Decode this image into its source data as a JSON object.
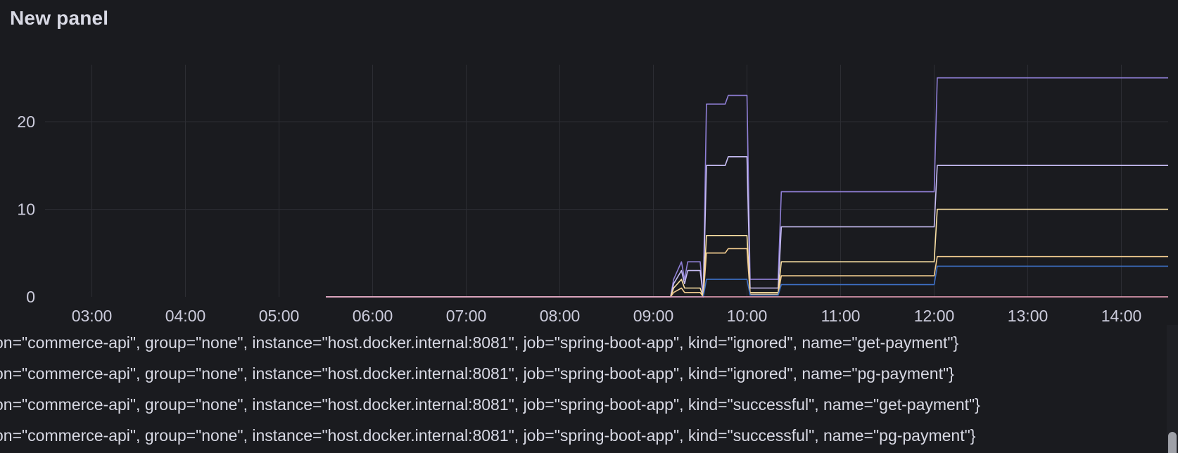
{
  "panel": {
    "title": "New panel"
  },
  "chart_data": {
    "type": "line",
    "title": "New panel",
    "xlabel": "",
    "ylabel": "",
    "xlim": [
      "02:30",
      "14:30"
    ],
    "ylim": [
      0,
      26.5
    ],
    "x_ticks": [
      "03:00",
      "04:00",
      "05:00",
      "06:00",
      "07:00",
      "08:00",
      "09:00",
      "10:00",
      "11:00",
      "12:00",
      "13:00",
      "14:00"
    ],
    "y_ticks": [
      0,
      10,
      20
    ],
    "grid": true,
    "legend_position": "bottom",
    "series": [
      {
        "label": "on=\"commerce-api\", group=\"none\", instance=\"host.docker.internal:8081\", job=\"spring-boot-app\", kind=\"ignored\", name=\"get-payment\"}",
        "color": "#8f7fd6",
        "points": [
          [
            "05:30",
            0
          ],
          [
            "09:11",
            0
          ],
          [
            "09:13",
            2
          ],
          [
            "09:18",
            4
          ],
          [
            "09:20",
            2
          ],
          [
            "09:22",
            4
          ],
          [
            "09:30",
            4
          ],
          [
            "09:32",
            0
          ],
          [
            "09:34",
            22
          ],
          [
            "09:46",
            22
          ],
          [
            "09:48",
            23
          ],
          [
            "10:00",
            23
          ],
          [
            "10:02",
            2
          ],
          [
            "10:20",
            2
          ],
          [
            "10:22",
            12
          ],
          [
            "12:00",
            12
          ],
          [
            "12:02",
            25
          ],
          [
            "14:30",
            25
          ]
        ]
      },
      {
        "label": "on=\"commerce-api\", group=\"none\", instance=\"host.docker.internal:8081\", job=\"spring-boot-app\", kind=\"ignored\", name=\"pg-payment\"}",
        "color": "#c7bdf4",
        "points": [
          [
            "05:30",
            0
          ],
          [
            "09:11",
            0
          ],
          [
            "09:13",
            1.5
          ],
          [
            "09:18",
            3
          ],
          [
            "09:20",
            1.5
          ],
          [
            "09:22",
            3
          ],
          [
            "09:30",
            3
          ],
          [
            "09:32",
            0
          ],
          [
            "09:34",
            15
          ],
          [
            "09:46",
            15
          ],
          [
            "09:48",
            16
          ],
          [
            "10:00",
            16
          ],
          [
            "10:02",
            1
          ],
          [
            "10:20",
            1
          ],
          [
            "10:22",
            8
          ],
          [
            "12:00",
            8
          ],
          [
            "12:02",
            15
          ],
          [
            "14:30",
            15
          ]
        ]
      },
      {
        "label": "on=\"commerce-api\", group=\"none\", instance=\"host.docker.internal:8081\", job=\"spring-boot-app\", kind=\"successful\", name=\"get-payment\"}",
        "color": "#fce2a4",
        "points": [
          [
            "05:30",
            0
          ],
          [
            "09:11",
            0
          ],
          [
            "09:13",
            1
          ],
          [
            "09:18",
            2
          ],
          [
            "09:20",
            1
          ],
          [
            "09:22",
            1
          ],
          [
            "09:30",
            1
          ],
          [
            "09:32",
            0
          ],
          [
            "09:34",
            7
          ],
          [
            "10:00",
            7
          ],
          [
            "10:02",
            0.5
          ],
          [
            "10:20",
            0.5
          ],
          [
            "10:22",
            4
          ],
          [
            "12:00",
            4
          ],
          [
            "12:02",
            10
          ],
          [
            "14:30",
            10
          ]
        ]
      },
      {
        "label": "on=\"commerce-api\", group=\"none\", instance=\"host.docker.internal:8081\", job=\"spring-boot-app\", kind=\"successful\", name=\"pg-payment\"}",
        "color": "#f2cc8f",
        "points": [
          [
            "05:30",
            0
          ],
          [
            "09:11",
            0
          ],
          [
            "09:13",
            0.5
          ],
          [
            "09:18",
            1
          ],
          [
            "09:20",
            0.5
          ],
          [
            "09:22",
            0.5
          ],
          [
            "09:30",
            0.5
          ],
          [
            "09:32",
            0
          ],
          [
            "09:34",
            5
          ],
          [
            "09:46",
            5
          ],
          [
            "09:48",
            5.5
          ],
          [
            "10:00",
            5.5
          ],
          [
            "10:02",
            0.3
          ],
          [
            "10:20",
            0.3
          ],
          [
            "10:22",
            2.4
          ],
          [
            "12:00",
            2.4
          ],
          [
            "12:02",
            4.6
          ],
          [
            "14:30",
            4.6
          ]
        ]
      },
      {
        "color": "#3d6fc4",
        "points": [
          [
            "05:30",
            0
          ],
          [
            "09:32",
            0
          ],
          [
            "09:34",
            2
          ],
          [
            "10:00",
            2
          ],
          [
            "10:02",
            0.2
          ],
          [
            "10:20",
            0.2
          ],
          [
            "10:22",
            1.4
          ],
          [
            "12:00",
            1.4
          ],
          [
            "12:02",
            3.5
          ],
          [
            "14:30",
            3.5
          ]
        ]
      },
      {
        "color": "#f5a8c0",
        "points": [
          [
            "05:30",
            0
          ],
          [
            "14:30",
            0
          ]
        ]
      }
    ]
  }
}
